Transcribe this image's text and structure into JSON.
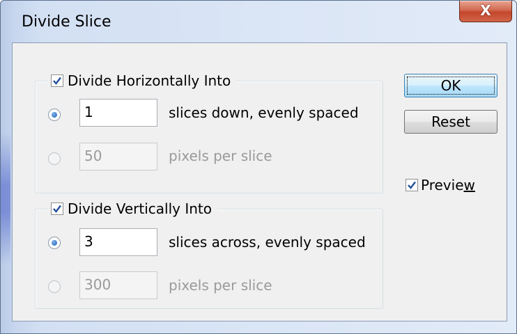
{
  "window": {
    "title": "Divide Slice",
    "close_glyph": "X"
  },
  "horizontal": {
    "legend": "Divide Horizontally Into",
    "checked": true,
    "slices_value": "1",
    "slices_label": "slices down, evenly spaced",
    "pixels_value": "50",
    "pixels_label": "pixels per slice",
    "selected_option": "slices"
  },
  "vertical": {
    "legend": "Divide Vertically Into",
    "checked": true,
    "slices_value": "3",
    "slices_label": "slices across, evenly spaced",
    "pixels_value": "300",
    "pixels_label": "pixels per slice",
    "selected_option": "slices"
  },
  "buttons": {
    "ok": "OK",
    "reset": "Reset"
  },
  "preview": {
    "label_main": "Previe",
    "label_accel": "w",
    "checked": true
  },
  "colors": {
    "check": "#1f4f9c",
    "accent": "#3c7fb1",
    "close": "#c4472c"
  }
}
